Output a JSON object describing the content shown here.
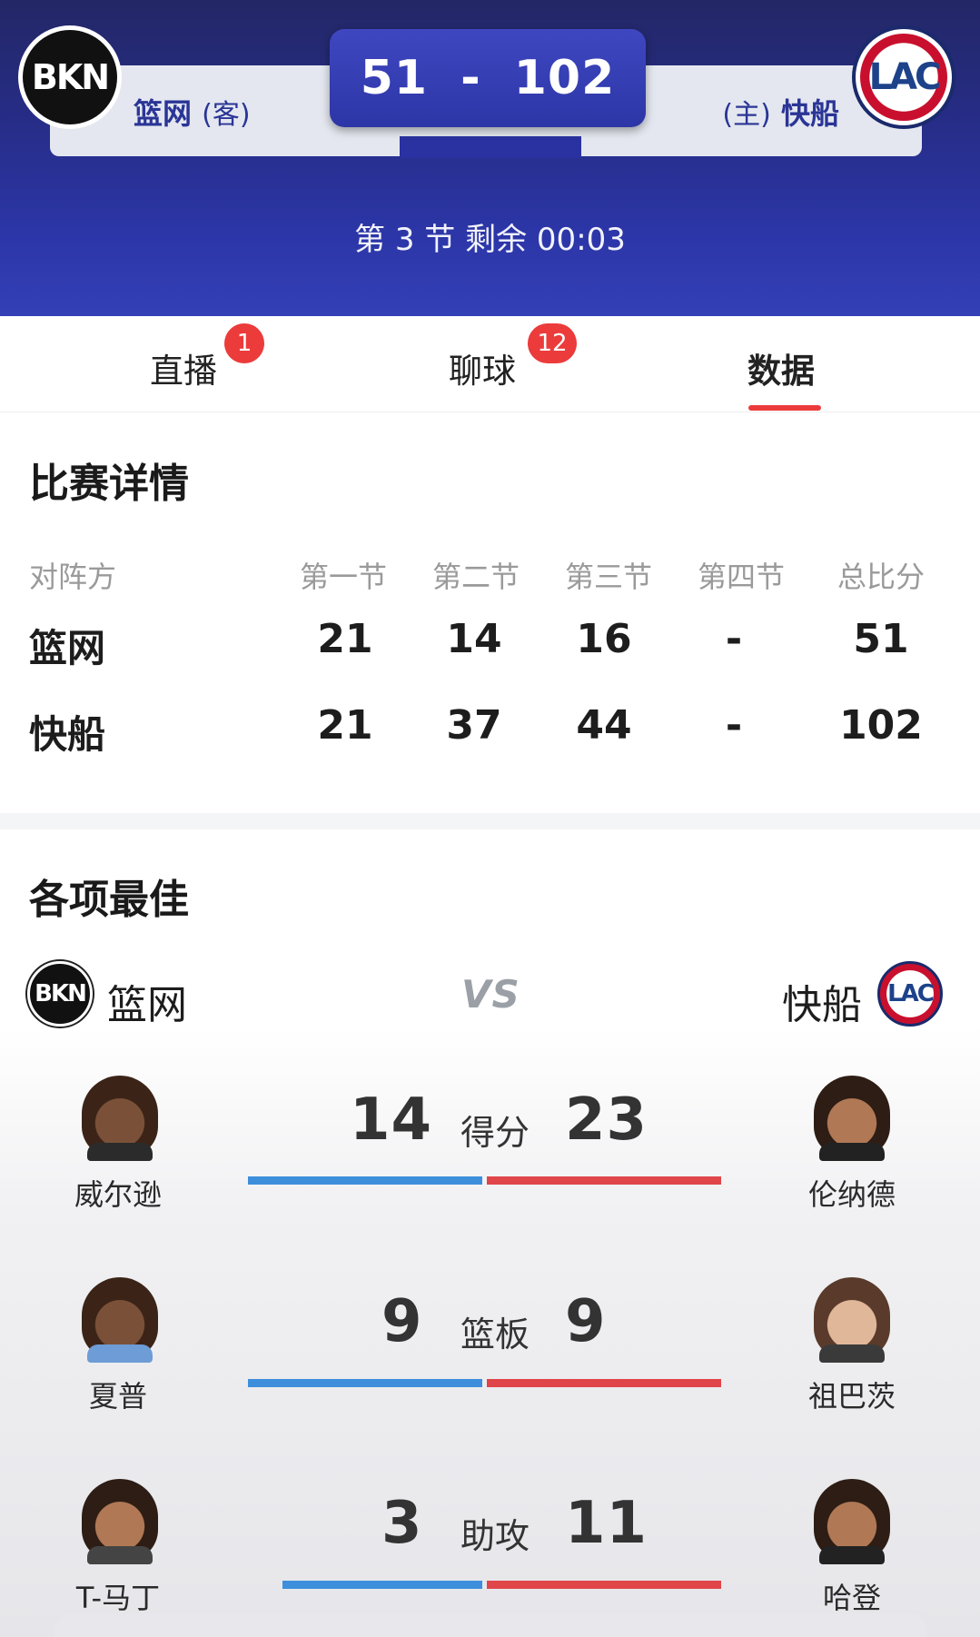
{
  "header": {
    "away_team": {
      "abbr": "BKN",
      "name": "篮网",
      "tag": "(客)",
      "score": "51"
    },
    "home_team": {
      "abbr": "LAC",
      "name": "快船",
      "tag": "(主)",
      "score": "102"
    },
    "score_separator": "-",
    "period_text": "第 3 节 剩余 00:03"
  },
  "tabs": [
    {
      "label": "直播",
      "badge": "1"
    },
    {
      "label": "聊球",
      "badge": "12"
    },
    {
      "label": "数据",
      "active": true
    }
  ],
  "match_details": {
    "title": "比赛详情",
    "columns": [
      "对阵方",
      "第一节",
      "第二节",
      "第三节",
      "第四节",
      "总比分"
    ],
    "rows": [
      {
        "team": "篮网",
        "q1": "21",
        "q2": "14",
        "q3": "16",
        "q4": "-",
        "total": "51"
      },
      {
        "team": "快船",
        "q1": "21",
        "q2": "37",
        "q3": "44",
        "q4": "-",
        "total": "102"
      }
    ]
  },
  "best_players": {
    "title": "各项最佳",
    "away_team": "篮网",
    "home_team": "快船",
    "vs": "VS",
    "stats": [
      {
        "label": "得分",
        "away_player": "威尔逊",
        "away_value": "14",
        "home_player": "伦纳德",
        "home_value": "23"
      },
      {
        "label": "篮板",
        "away_player": "夏普",
        "away_value": "9",
        "home_player": "祖巴茨",
        "home_value": "9"
      },
      {
        "label": "助攻",
        "away_player": "T-马丁",
        "away_value": "3",
        "home_player": "哈登",
        "home_value": "11"
      }
    ]
  },
  "colors": {
    "away_bar": "#3d8edb",
    "home_bar": "#e0454a",
    "badge": "#ec3b3b",
    "header_bg": "#262c84"
  }
}
